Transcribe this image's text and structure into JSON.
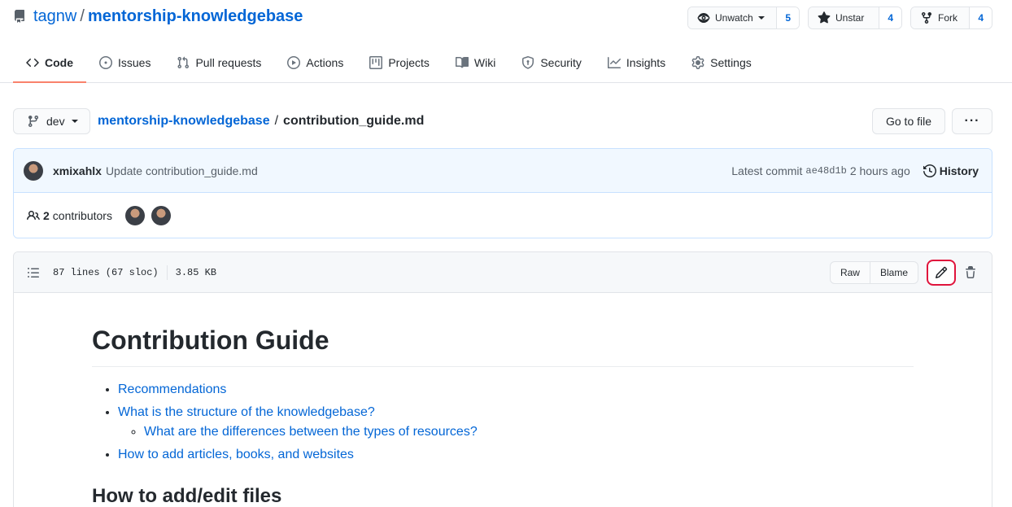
{
  "repo": {
    "owner": "tagnw",
    "separator": "/",
    "name": "mentorship-knowledgebase"
  },
  "social": {
    "watch": {
      "label": "Unwatch",
      "count": "5"
    },
    "star": {
      "label": "Unstar",
      "count": "4"
    },
    "fork": {
      "label": "Fork",
      "count": "4"
    }
  },
  "tabs": [
    {
      "label": "Code",
      "icon": "code-icon"
    },
    {
      "label": "Issues",
      "icon": "issue-icon"
    },
    {
      "label": "Pull requests",
      "icon": "pull-request-icon"
    },
    {
      "label": "Actions",
      "icon": "play-icon"
    },
    {
      "label": "Projects",
      "icon": "project-icon"
    },
    {
      "label": "Wiki",
      "icon": "book-icon"
    },
    {
      "label": "Security",
      "icon": "shield-icon"
    },
    {
      "label": "Insights",
      "icon": "graph-icon"
    },
    {
      "label": "Settings",
      "icon": "gear-icon"
    }
  ],
  "nav": {
    "branch": "dev",
    "crumb_repo": "mentorship-knowledgebase",
    "crumb_sep": "/",
    "crumb_file": "contribution_guide.md",
    "goto_file": "Go to file",
    "more": "···"
  },
  "commit": {
    "author": "xmixahlx",
    "message": "Update contribution_guide.md",
    "latest_label": "Latest commit",
    "sha": "ae48d1b",
    "time": "2 hours ago",
    "history": "History"
  },
  "contributors": {
    "count": "2",
    "label": "contributors"
  },
  "file": {
    "lines": "87 lines (67 sloc)",
    "size": "3.85 KB",
    "raw": "Raw",
    "blame": "Blame"
  },
  "readme": {
    "title": "Contribution Guide",
    "toc": [
      "Recommendations",
      "What is the structure of the knowledgebase?",
      "What are the differences between the types of resources?",
      "How to add articles, books, and websites"
    ],
    "h2": "How to add/edit files"
  },
  "colors": {
    "link": "#0366d6",
    "active_tab": "#f9826c",
    "edit_highlight": "#e0143c"
  }
}
